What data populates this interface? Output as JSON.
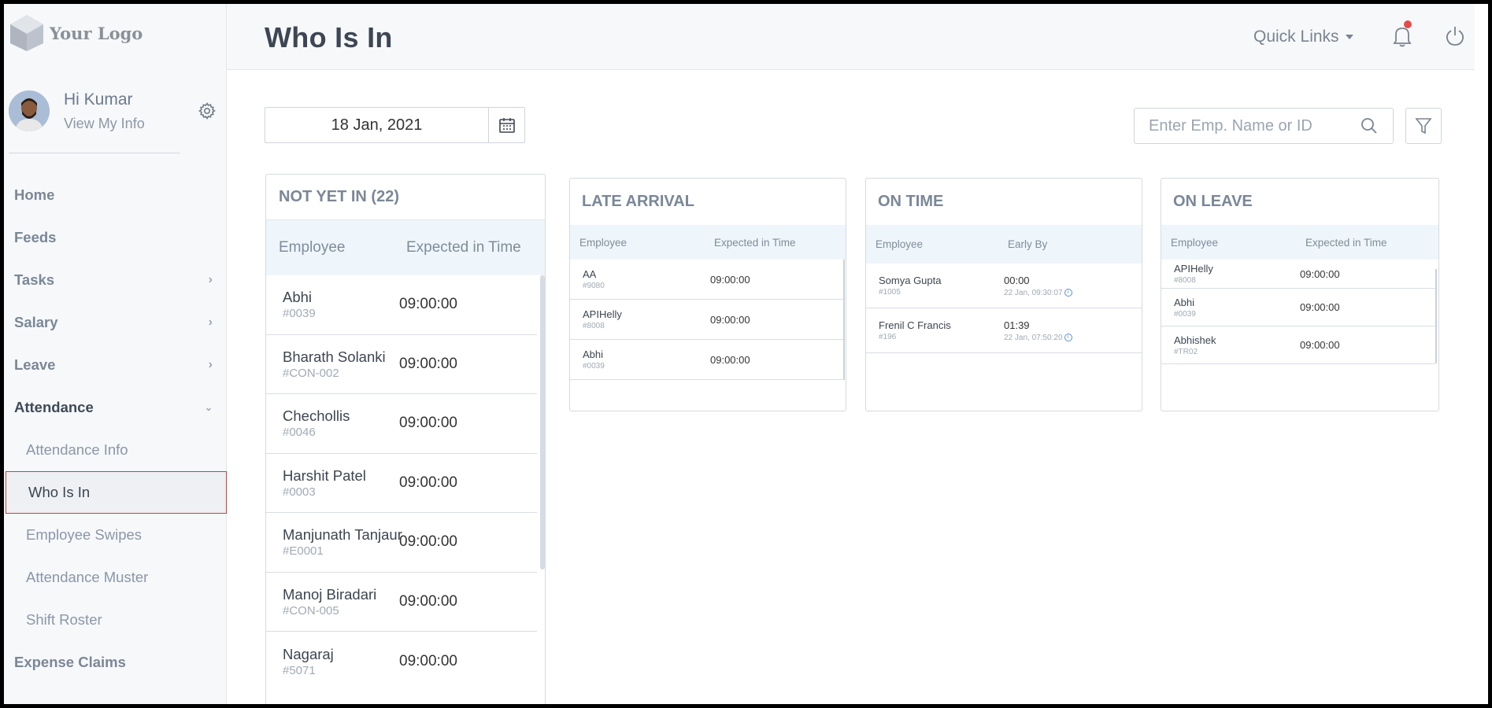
{
  "logo": {
    "text": "Your Logo"
  },
  "user": {
    "greeting": "Hi Kumar",
    "link": "View My Info"
  },
  "nav": {
    "home": "Home",
    "feeds": "Feeds",
    "tasks": "Tasks",
    "salary": "Salary",
    "leave": "Leave",
    "attendance": "Attendance",
    "attendance_info": "Attendance Info",
    "who_is_in": "Who Is In",
    "employee_swipes": "Employee Swipes",
    "attendance_muster": "Attendance Muster",
    "shift_roster": "Shift Roster",
    "expense_claims": "Expense Claims"
  },
  "header": {
    "title": "Who Is In",
    "quick_links": "Quick Links"
  },
  "date": {
    "value": "18 Jan, 2021"
  },
  "search": {
    "placeholder": "Enter Emp. Name or ID"
  },
  "not_yet_in": {
    "title": "NOT YET IN (22)",
    "col_employee": "Employee",
    "col_time": "Expected in Time",
    "rows": [
      {
        "name": "Abhi",
        "id": "#0039",
        "time": "09:00:00"
      },
      {
        "name": "Bharath Solanki",
        "id": "#CON-002",
        "time": "09:00:00"
      },
      {
        "name": "Chechollis",
        "id": "#0046",
        "time": "09:00:00"
      },
      {
        "name": "Harshit Patel",
        "id": "#0003",
        "time": "09:00:00"
      },
      {
        "name": "Manjunath Tanjaur",
        "id": "#E0001",
        "time": "09:00:00"
      },
      {
        "name": "Manoj Biradari",
        "id": "#CON-005",
        "time": "09:00:00"
      },
      {
        "name": "Nagaraj",
        "id": "#5071",
        "time": "09:00:00"
      }
    ]
  },
  "late_arrival": {
    "title": "LATE ARRIVAL",
    "col_employee": "Employee",
    "col_time": "Expected in Time",
    "rows": [
      {
        "name": "AA",
        "id": "#9080",
        "time": "09:00:00"
      },
      {
        "name": "APIHelly",
        "id": "#8008",
        "time": "09:00:00"
      },
      {
        "name": "Abhi",
        "id": "#0039",
        "time": "09:00:00"
      }
    ]
  },
  "on_time": {
    "title": "ON TIME",
    "col_employee": "Employee",
    "col_time": "Early By",
    "rows": [
      {
        "name": "Somya Gupta",
        "id": "#1005",
        "time": "00:00",
        "sub": "22 Jan, 09:30:07"
      },
      {
        "name": "Frenil C Francis",
        "id": "#196",
        "time": "01:39",
        "sub": "22 Jan, 07:50:20"
      }
    ]
  },
  "on_leave": {
    "title": "ON LEAVE",
    "col_employee": "Employee",
    "col_time": "Expected in Time",
    "rows": [
      {
        "name": "APIHelly",
        "id": "#8008",
        "time": "09:00:00"
      },
      {
        "name": "Abhi",
        "id": "#0039",
        "time": "09:00:00"
      },
      {
        "name": "Abhishek",
        "id": "#TR02",
        "time": "09:00:00"
      }
    ]
  }
}
